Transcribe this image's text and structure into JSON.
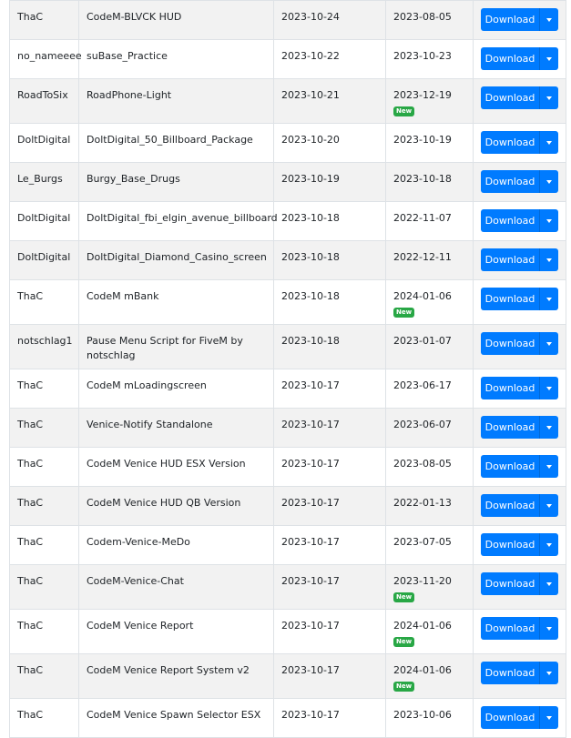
{
  "table": {
    "download_label": "Download",
    "new_label": "New",
    "rows": [
      {
        "author": "ThaC",
        "name": "CodeM-BLVCK HUD",
        "added": "2023-10-24",
        "updated": "2023-08-05",
        "is_new": false
      },
      {
        "author": "no_nameeee",
        "name": "suBase_Practice",
        "added": "2023-10-22",
        "updated": "2023-10-23",
        "is_new": false
      },
      {
        "author": "RoadToSix",
        "name": "RoadPhone-Light",
        "added": "2023-10-21",
        "updated": "2023-12-19",
        "is_new": true
      },
      {
        "author": "DoltDigital",
        "name": "DoltDigital_50_Billboard_Package",
        "added": "2023-10-20",
        "updated": "2023-10-19",
        "is_new": false
      },
      {
        "author": "Le_Burgs",
        "name": "Burgy_Base_Drugs",
        "added": "2023-10-19",
        "updated": "2023-10-18",
        "is_new": false
      },
      {
        "author": "DoltDigital",
        "name": "DoltDigital_fbi_elgin_avenue_billboard",
        "added": "2023-10-18",
        "updated": "2022-11-07",
        "is_new": false
      },
      {
        "author": "DoltDigital",
        "name": "DoltDigital_Diamond_Casino_screen",
        "added": "2023-10-18",
        "updated": "2022-12-11",
        "is_new": false
      },
      {
        "author": "ThaC",
        "name": "CodeM mBank",
        "added": "2023-10-18",
        "updated": "2024-01-06",
        "is_new": true
      },
      {
        "author": "notschlag1",
        "name": "Pause Menu Script for FiveM by notschlag",
        "added": "2023-10-18",
        "updated": "2023-01-07",
        "is_new": false
      },
      {
        "author": "ThaC",
        "name": "CodeM mLoadingscreen",
        "added": "2023-10-17",
        "updated": "2023-06-17",
        "is_new": false
      },
      {
        "author": "ThaC",
        "name": "Venice-Notify Standalone",
        "added": "2023-10-17",
        "updated": "2023-06-07",
        "is_new": false
      },
      {
        "author": "ThaC",
        "name": "CodeM Venice HUD ESX Version",
        "added": "2023-10-17",
        "updated": "2023-08-05",
        "is_new": false
      },
      {
        "author": "ThaC",
        "name": "CodeM Venice HUD QB Version",
        "added": "2023-10-17",
        "updated": "2022-01-13",
        "is_new": false
      },
      {
        "author": "ThaC",
        "name": "Codem-Venice-MeDo",
        "added": "2023-10-17",
        "updated": "2023-07-05",
        "is_new": false
      },
      {
        "author": "ThaC",
        "name": "CodeM-Venice-Chat",
        "added": "2023-10-17",
        "updated": "2023-11-20",
        "is_new": true
      },
      {
        "author": "ThaC",
        "name": "CodeM Venice Report",
        "added": "2023-10-17",
        "updated": "2024-01-06",
        "is_new": true
      },
      {
        "author": "ThaC",
        "name": "CodeM Venice Report System v2",
        "added": "2023-10-17",
        "updated": "2024-01-06",
        "is_new": true
      },
      {
        "author": "ThaC",
        "name": "CodeM Venice Spawn Selector ESX",
        "added": "2023-10-17",
        "updated": "2023-10-06",
        "is_new": false
      }
    ]
  },
  "colors": {
    "download_button": "#007bff",
    "new_badge": "#28a745",
    "row_stripe": "#f2f2f2",
    "border": "#dee2e6"
  },
  "icons": {
    "dropdown_toggle": "caret-down-icon"
  }
}
